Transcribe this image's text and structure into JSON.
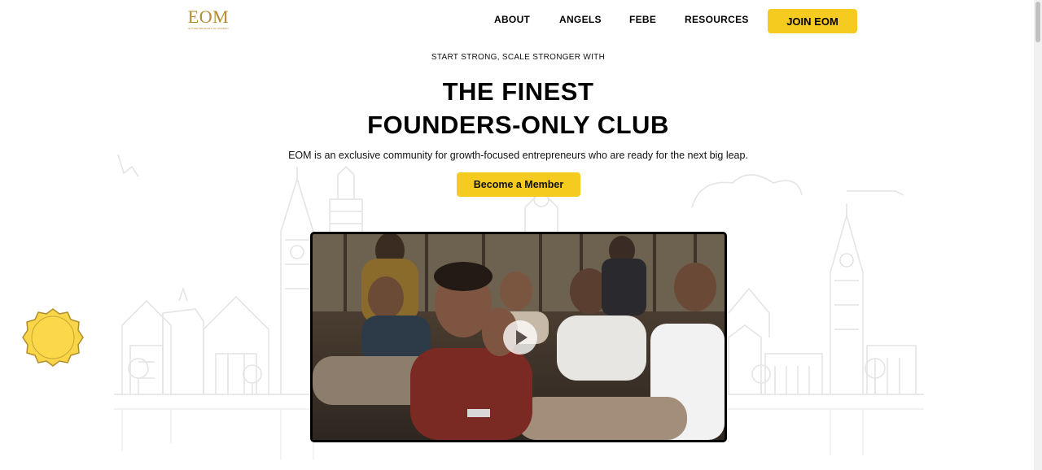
{
  "brand": {
    "name": "EOM",
    "tagline": "ENTREPRENEURS OF MUMBAI",
    "logo_color": "#b48a2c"
  },
  "nav": {
    "links": [
      "ABOUT",
      "ANGELS",
      "FEBE",
      "RESOURCES"
    ],
    "cta": "JOIN EOM"
  },
  "hero": {
    "kicker": "START STRONG, SCALE STRONGER WITH",
    "headline_line1": "THE FINEST",
    "headline_line2": "FOUNDERS-ONLY CLUB",
    "subtitle": "EOM is an exclusive community for growth-focused entrepreneurs who are ready for the next big leap.",
    "cta": "Become a Member"
  },
  "video": {
    "icon": "play-icon"
  },
  "colors": {
    "accent": "#f6cb1f",
    "text": "#000000",
    "skyline": "#e6e6e6"
  }
}
